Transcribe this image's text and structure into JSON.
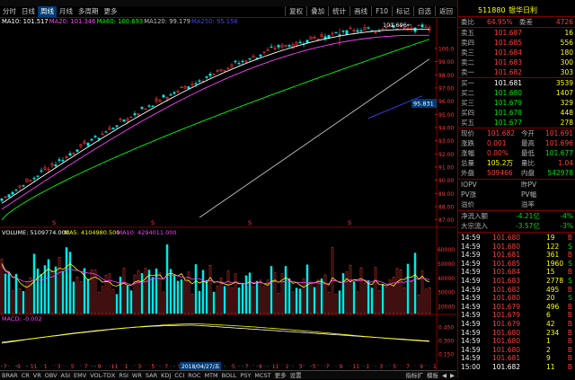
{
  "toolbar": {
    "left_tabs": [
      "分时",
      "日线",
      "周线",
      "月线",
      "多周期",
      "更多"
    ],
    "active_tab": "周线",
    "right_buttons": [
      "复权",
      "叠加",
      "统计",
      "画线",
      "F10",
      "标记",
      "自选",
      "返回"
    ]
  },
  "main_chart": {
    "ma_labels": [
      {
        "text": "MA10: 101.517",
        "color": "#ffffff"
      },
      {
        "text": "MA20: 101.346",
        "color": "#ff40ff"
      },
      {
        "text": "MA60: 100.693",
        "color": "#00ff00"
      },
      {
        "text": "MA120: 99.179",
        "color": "#c0c0c0"
      },
      {
        "text": "MA250: 95.156",
        "color": "#4040ff"
      }
    ],
    "high_label": "101.696",
    "current_price_tag": "95.831",
    "yaxis": [
      "100.0",
      "99.00",
      "98.00",
      "97.00",
      "96.00",
      "95.00",
      "94.00",
      "93.00",
      "92.00",
      "91.00",
      "90.00",
      "89.00",
      "88.00",
      "87.00"
    ],
    "event_markers": [
      "S",
      "S",
      "S",
      "S"
    ]
  },
  "volume_chart": {
    "labels": [
      {
        "text": "VOLUME: 5109774.000",
        "color": "#ffffff"
      },
      {
        "text": "MA5: 4104980.500",
        "color": "#ffff00"
      },
      {
        "text": "MA10: 4294011.000",
        "color": "#ff40ff"
      }
    ],
    "yaxis": [
      "60000",
      "50000",
      "40000",
      "30000",
      "20000"
    ]
  },
  "macd_chart": {
    "label": "MACD: -0.002",
    "yaxis": [
      "0.450",
      "0.300",
      "0.150"
    ]
  },
  "x_axis": {
    "ticks": [
      "7",
      "9",
      "11",
      "1",
      "3",
      "5",
      "7",
      "9",
      "11",
      "1",
      "3",
      "5",
      "7",
      "9",
      "11",
      "1",
      "3",
      "5",
      "7",
      "9",
      "11",
      "1",
      "3",
      "5",
      "7",
      "9",
      "11",
      "1",
      "3",
      "5",
      "7",
      "9",
      "1"
    ],
    "cursor_date": "2018/04/27/五"
  },
  "indicator_tabs": [
    "BRAR",
    "CR",
    "VR",
    "OBV",
    "ASI",
    "EMV",
    "VOL-TDX",
    "RSI",
    "WR",
    "SAR",
    "KDJ",
    "CCI",
    "ROC",
    "MTM",
    "BOLL",
    "PSY",
    "MCST",
    "更多",
    "设置"
  ],
  "indicator_tabs_right": [
    "指标扩",
    "模板",
    "◀",
    "▶"
  ],
  "quote": {
    "code": "511880",
    "name": "银华日利",
    "weibi_label": "委比",
    "weibi_value": "64.95%",
    "weicha_label": "委差",
    "weicha_value": "4726",
    "asks": [
      {
        "label": "卖五",
        "price": "101.687",
        "vol": "16"
      },
      {
        "label": "卖四",
        "price": "101.685",
        "vol": "556"
      },
      {
        "label": "卖三",
        "price": "101.684",
        "vol": "180"
      },
      {
        "label": "卖二",
        "price": "101.683",
        "vol": "300"
      },
      {
        "label": "卖一",
        "price": "101.682",
        "vol": "303"
      }
    ],
    "bids": [
      {
        "label": "买一",
        "price": "101.681",
        "vol": "3539"
      },
      {
        "label": "买二",
        "price": "101.680",
        "vol": "1407"
      },
      {
        "label": "买三",
        "price": "101.679",
        "vol": "329"
      },
      {
        "label": "买四",
        "price": "101.678",
        "vol": "448"
      },
      {
        "label": "买五",
        "price": "101.677",
        "vol": "278"
      }
    ],
    "stats": [
      {
        "l1": "现价",
        "v1": "101.682",
        "c1": "#ff3c3c",
        "l2": "今开",
        "v2": "101.691",
        "c2": "#ff3c3c"
      },
      {
        "l1": "涨跌",
        "v1": "0.001",
        "c1": "#ff3c3c",
        "l2": "最高",
        "v2": "101.696",
        "c2": "#ff3c3c"
      },
      {
        "l1": "涨幅",
        "v1": "0.00%",
        "c1": "#ff3c3c",
        "l2": "最低",
        "v2": "101.677",
        "c2": "#00e000"
      },
      {
        "l1": "总量",
        "v1": "105.2万",
        "c1": "#ffff00",
        "l2": "量比",
        "v2": "1.04",
        "c2": "#ff3c3c"
      },
      {
        "l1": "外盘",
        "v1": "509466",
        "c1": "#ff3c3c",
        "l2": "内盘",
        "v2": "542978",
        "c2": "#00e000"
      }
    ],
    "extra": [
      {
        "l1": "IOPV",
        "v1": "",
        "l2": "昨PV",
        "v2": ""
      },
      {
        "l1": "PV涨",
        "v1": "",
        "l2": "PV幅",
        "v2": ""
      },
      {
        "l1": "溢价",
        "v1": "",
        "l2": "溢率",
        "v2": ""
      }
    ],
    "flows": [
      {
        "label": "净流入额",
        "value": "-4.21亿",
        "pct": "-4%"
      },
      {
        "label": "大宗流入",
        "value": "-3.57亿",
        "pct": "-3%"
      }
    ],
    "ticks": [
      {
        "t": "14:59",
        "p": "101.680",
        "v": "19",
        "d": "B"
      },
      {
        "t": "14:59",
        "p": "101.680",
        "v": "122",
        "d": "S"
      },
      {
        "t": "14:59",
        "p": "101.681",
        "v": "361",
        "d": "B"
      },
      {
        "t": "14:59",
        "p": "101.685",
        "v": "1960",
        "d": "S"
      },
      {
        "t": "14:59",
        "p": "101.684",
        "v": "15",
        "d": "B"
      },
      {
        "t": "14:59",
        "p": "101.683",
        "v": "2778",
        "d": "S"
      },
      {
        "t": "14:59",
        "p": "101.682",
        "v": "495",
        "d": "B"
      },
      {
        "t": "14:59",
        "p": "101.680",
        "v": "20",
        "d": "S"
      },
      {
        "t": "14:59",
        "p": "101.679",
        "v": "496",
        "d": "B"
      },
      {
        "t": "14:59",
        "p": "101.679",
        "v": "6",
        "d": "B"
      },
      {
        "t": "14:59",
        "p": "101.679",
        "v": "42",
        "d": "B"
      },
      {
        "t": "14:59",
        "p": "101.680",
        "v": "234",
        "d": "B"
      },
      {
        "t": "14:59",
        "p": "101.680",
        "v": "1",
        "d": "B"
      },
      {
        "t": "14:59",
        "p": "101.680",
        "v": "2",
        "d": "B"
      },
      {
        "t": "14:59",
        "p": "101.681",
        "v": "9",
        "d": "B"
      },
      {
        "t": "15:00",
        "p": "101.682",
        "v": "11",
        "d": "B"
      }
    ]
  },
  "colors": {
    "up": "#ff3c3c",
    "down": "#00e000",
    "panel_border": "#800000",
    "ma10": "#ffffff",
    "ma20": "#ff40ff",
    "ma60": "#00ff00",
    "ma120": "#c0c0c0",
    "ma250": "#4040ff"
  }
}
